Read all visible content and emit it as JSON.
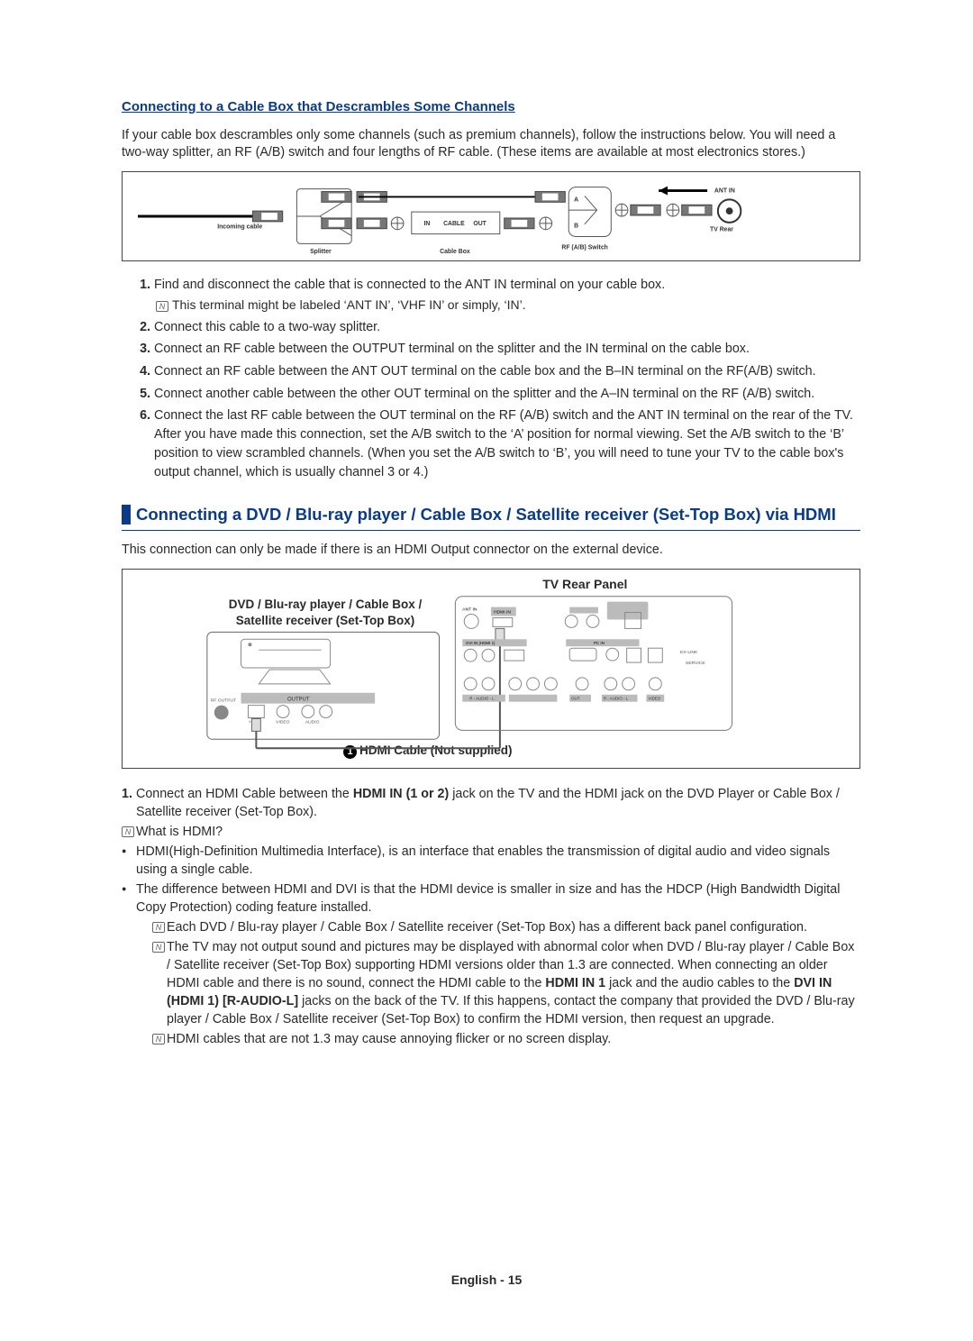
{
  "section1": {
    "heading": "Connecting to a Cable Box that Descrambles Some Channels",
    "intro": "If your cable box descrambles only some channels (such as premium channels), follow the instructions below. You will need a two-way splitter, an RF (A/B) switch and four lengths of RF cable. (These items are available at most electronics stores.)",
    "diagram": {
      "incoming": "Incoming cable",
      "splitter": "Splitter",
      "cablebox": "Cable Box",
      "in": "IN",
      "cable": "CABLE",
      "out": "OUT",
      "a": "A",
      "b": "B",
      "rfswitch": "RF (A/B) Switch",
      "antin": "ANT IN",
      "tvrear": "TV Rear"
    },
    "steps": [
      {
        "text": "Find and disconnect the cable that is connected to the ANT IN terminal on your cable box.",
        "note": "This terminal might be labeled ‘ANT IN’, ‘VHF IN’ or simply, ‘IN’."
      },
      {
        "text": "Connect this cable to a two-way splitter."
      },
      {
        "text": "Connect an RF cable between the OUTPUT terminal on the splitter and the IN terminal on the cable box."
      },
      {
        "text": "Connect an RF cable between the ANT OUT terminal on the cable box and the B–IN terminal on the RF(A/B) switch."
      },
      {
        "text": "Connect another cable between the other OUT terminal on the splitter and the A–IN terminal on the RF (A/B) switch."
      },
      {
        "pre": "Connect the last RF cable between the OUT terminal on the RF (A/B) switch and the ",
        "bold": "ANT IN",
        "post": " terminal on the rear of the TV. After you have made this connection, set the A/B switch to the ‘A’ position for normal viewing. Set the A/B switch to the ‘B’ position to view scrambled channels. (When you set the A/B switch to ‘B’, you will need to tune your TV to the cable box's output channel, which is usually channel 3 or 4.)"
      }
    ]
  },
  "section2": {
    "title": "Connecting a DVD / Blu-ray player / Cable Box / Satellite receiver (Set-Top Box) via HDMI",
    "intro": "This connection can only be made if there is an HDMI Output connector on the external device.",
    "diagram": {
      "rearpanel": "TV Rear Panel",
      "device": "DVD / Blu-ray player / Cable Box / Satellite receiver (Set-Top Box)",
      "hdmicable_num": "1",
      "hdmicable": "HDMI Cable (Not supplied)"
    },
    "step_num": "1.",
    "step_pre": "Connect an HDMI Cable between the ",
    "step_bold": "HDMI IN (1 or 2)",
    "step_post": " jack on the TV and the HDMI jack on the DVD Player or Cable Box / Satellite receiver (Set-Top Box).",
    "whatis": "What is HDMI?",
    "b1": "HDMI(High-Definition Multimedia Interface), is an interface that enables the transmission of digital audio and video signals using a single cable.",
    "b2": "The difference between HDMI and DVI is that the HDMI device is smaller in size and has the HDCP (High Bandwidth Digital Copy Protection) coding feature installed.",
    "n1": "Each DVD / Blu-ray player / Cable Box / Satellite receiver (Set-Top Box) has a different back panel configuration.",
    "n2_pre": "The TV may not output sound and pictures may be displayed with abnormal color when DVD / Blu-ray player / Cable Box / Satellite receiver (Set-Top Box) supporting HDMI versions older than 1.3 are connected. When connecting an older HDMI cable and there is no sound, connect the HDMI cable to the ",
    "n2_b1": "HDMI IN 1",
    "n2_mid": " jack and the audio cables to the ",
    "n2_b2": "DVI IN (HDMI 1) [R-AUDIO-L]",
    "n2_post": " jacks on the back of the TV. If this happens, contact the company that provided the DVD / Blu-ray player / Cable Box / Satellite receiver (Set-Top Box) to confirm the HDMI version, then request an upgrade.",
    "n3": "HDMI cables that are not 1.3 may cause annoying flicker or no screen display."
  },
  "footer": {
    "lang": "English - ",
    "page": "15"
  }
}
